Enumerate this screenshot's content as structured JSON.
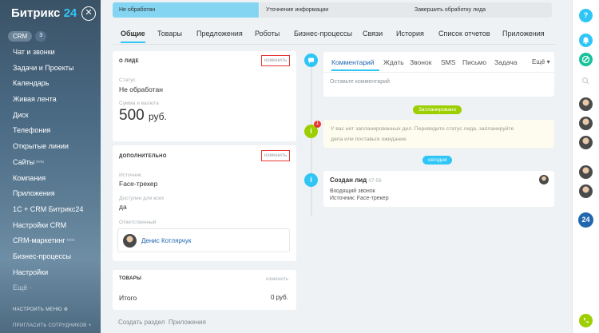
{
  "sidebar": {
    "logo_text": "Битрикс",
    "logo_num": "24",
    "close": "✕",
    "crm_label": "CRM",
    "crm_count": "3",
    "items": [
      {
        "label": "Чат и звонки",
        "dim": false
      },
      {
        "label": "Задачи и Проекты",
        "dim": false
      },
      {
        "label": "Календарь",
        "dim": false
      },
      {
        "label": "Живая лента",
        "dim": false
      },
      {
        "label": "Диск",
        "dim": false
      },
      {
        "label": "Телефония",
        "dim": false
      },
      {
        "label": "Открытые линии",
        "dim": false
      },
      {
        "label": "Сайты",
        "dim": false,
        "sup": "beta"
      },
      {
        "label": "Компания",
        "dim": false
      },
      {
        "label": "Приложения",
        "dim": false
      },
      {
        "label": "1С + CRM Битрикс24",
        "dim": false
      },
      {
        "label": "Настройки CRM",
        "dim": false
      },
      {
        "label": "CRM-маркетинг",
        "dim": false,
        "sup": "beta"
      },
      {
        "label": "Бизнес-процессы",
        "dim": false
      },
      {
        "label": "Настройки",
        "dim": false
      },
      {
        "label": "Ещё ·",
        "dim": true
      }
    ],
    "setup_menu": "НАСТРОИТЬ МЕНЮ  ⚙",
    "invite": "ПРИГЛАСИТЬ СОТРУДНИКОВ  +"
  },
  "stages": {
    "active": "Не обработан",
    "s2": "Уточнение информации",
    "s3": "Завершить обработку лида"
  },
  "tabs": [
    "Общие",
    "Товары",
    "Предложения",
    "Роботы",
    "Бизнес-процессы",
    "Связи",
    "История",
    "Список отчетов",
    "Приложения"
  ],
  "about": {
    "title": "О ЛИДЕ",
    "edit": "изменить",
    "status_label": "Статус",
    "status_value": "Не обработан",
    "amount_label": "Сумма и валюта",
    "amount_value": "500",
    "amount_currency": "руб."
  },
  "extra": {
    "title": "ДОПОЛНИТЕЛЬНО",
    "edit": "изменить",
    "source_label": "Источник",
    "source_value": "Face-трекер",
    "available_label": "Доступен для всех",
    "available_value": "да",
    "responsible_label": "Ответственный",
    "responsible_name": "Денис Котлярчук"
  },
  "goods": {
    "title": "ТОВАРЫ",
    "edit": "изменить",
    "total_label": "Итого",
    "total_value": "0 руб."
  },
  "bottom_links": {
    "create": "Создать раздел",
    "apps": "Приложения"
  },
  "composer": {
    "tabs": [
      "Комментарий",
      "Ждать",
      "Звонок",
      "SMS",
      "Письмо",
      "Задача"
    ],
    "more": "Ещё ▾",
    "placeholder": "Оставьте комментарий"
  },
  "timeline": {
    "planned_badge": "Запланировано",
    "planned_count": "1",
    "planned_text_1": "У вас нет запланированных дел. Переведите статус лида, запланируйте",
    "planned_text_2": "дела или поставьте ожидание",
    "today_badge": "сегодня",
    "event_title": "Создан лид",
    "event_time": "07:56",
    "event_line1": "Входящий звонок",
    "event_line2": "Источник: Face-трекер"
  },
  "rail": {
    "help": "?",
    "bitrix_badge": "24"
  },
  "colors": {
    "accent": "#2fc6f6",
    "green": "#9dcf00",
    "red": "#e83737",
    "sidebar": "#3a5266"
  }
}
